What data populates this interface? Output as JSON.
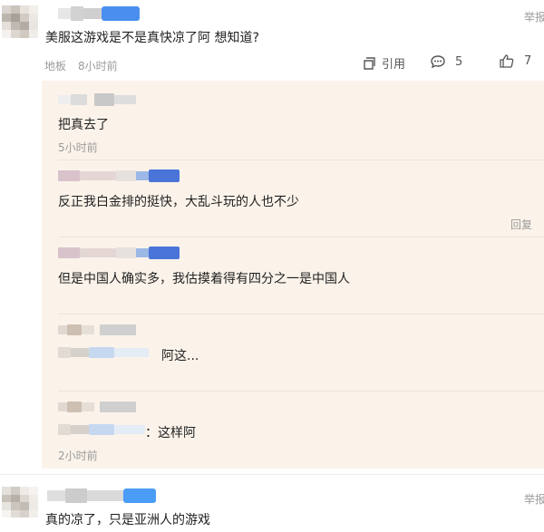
{
  "comments": [
    {
      "text": "美服这游戏是不是真快凉了阿 想知道?",
      "floor": "地板",
      "time": "8小时前",
      "report": "举报",
      "actions": {
        "quote": "引用",
        "comments": "5",
        "likes": "7"
      }
    },
    {
      "text": "真的凉了，只是亚洲人的游戏",
      "report": "举报"
    }
  ],
  "replies": [
    {
      "text": "把真去了",
      "time": "5小时前"
    },
    {
      "text": "反正我白金排的挺快，大乱斗玩的人也不少",
      "reply": "回复"
    },
    {
      "text": "但是中国人确实多，我估摸着得有四分之一是中国人"
    },
    {
      "text": "阿这..."
    },
    {
      "text": "：这样阿",
      "time": "2小时前"
    }
  ],
  "icons": {
    "quote": "quote-icon",
    "comment": "comment-bubble-icon",
    "like": "thumbs-up-icon"
  },
  "colors": {
    "panel_bg": "#fbf3ea",
    "meta_text": "#9b9b9b",
    "mosaic_blue": "#4a8ff0"
  }
}
